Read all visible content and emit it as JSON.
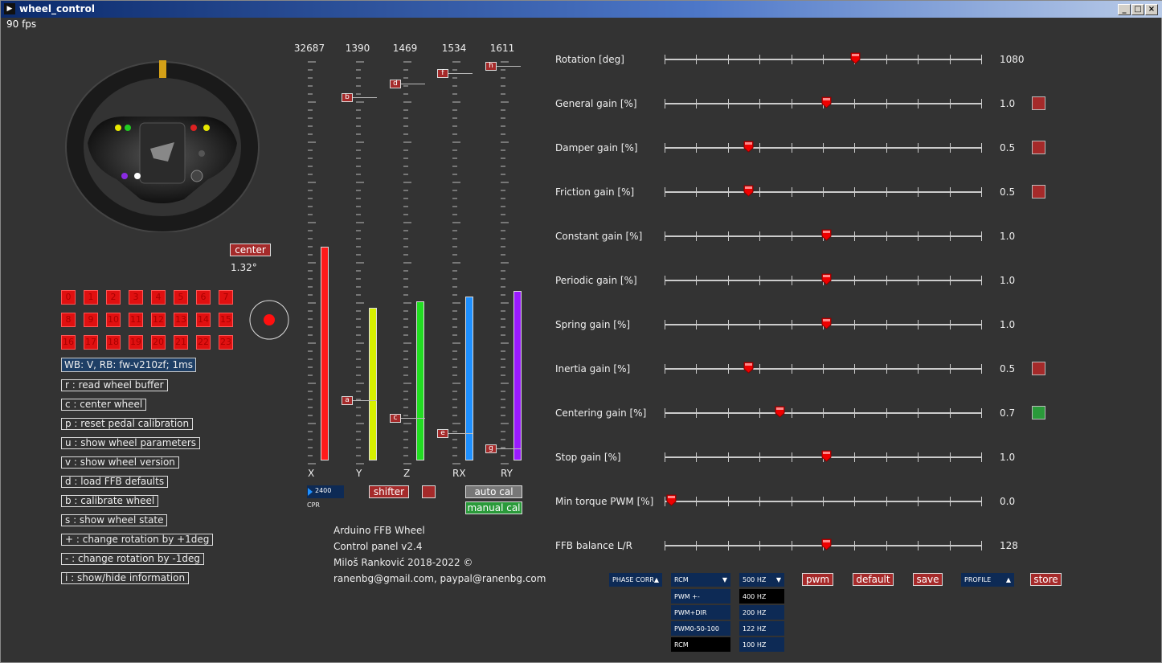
{
  "window": {
    "title": "wheel_control",
    "fps": "90 fps"
  },
  "wheel": {
    "center_label": "center",
    "angle": "1.32°"
  },
  "buttons": [
    "0",
    "1",
    "2",
    "3",
    "4",
    "5",
    "6",
    "7",
    "8",
    "9",
    "10",
    "11",
    "12",
    "13",
    "14",
    "15",
    "16",
    "17",
    "18",
    "19",
    "20",
    "21",
    "22",
    "23"
  ],
  "info_box": "WB: V, RB: fw-v210zf; 1ms",
  "commands": [
    "r : read wheel buffer",
    "c : center wheel",
    "p : reset pedal calibration",
    "u : show wheel parameters",
    "v : show wheel version",
    "d : load FFB defaults",
    "b : calibrate wheel",
    "s : show wheel state",
    "+ : change rotation by +1deg",
    "- : change rotation by -1deg",
    "i : show/hide information"
  ],
  "axes": [
    {
      "name": "X",
      "value": "32687",
      "color": "#ff1a1a",
      "fill": 0.555,
      "marker": ""
    },
    {
      "name": "Y",
      "value": "1390",
      "color": "#d6f000",
      "fill": 0.395,
      "marker": "a",
      "marker_top": "b"
    },
    {
      "name": "Z",
      "value": "1469",
      "color": "#22dd22",
      "fill": 0.413,
      "marker": "c",
      "marker_top": "d"
    },
    {
      "name": "RX",
      "value": "1534",
      "color": "#1e90ff",
      "fill": 0.426,
      "marker": "e",
      "marker_top": "f"
    },
    {
      "name": "RY",
      "value": "1611",
      "color": "#9a1aff",
      "fill": 0.44,
      "marker": "g",
      "marker_top": "h"
    }
  ],
  "cpr": {
    "value": "2400",
    "label": "CPR"
  },
  "shifter_label": "shifter",
  "auto_cal_label": "auto cal",
  "manual_cal_label": "manual cal",
  "about": [
    "Arduino FFB Wheel",
    "Control panel v2.4",
    "Miloš Ranković 2018-2022 ©",
    "ranenbg@gmail.com, paypal@ranenbg.com"
  ],
  "sliders": [
    {
      "label": "Rotation [deg]",
      "value": "1080",
      "pos": 0.595,
      "box": ""
    },
    {
      "label": "General gain [%]",
      "value": "1.0",
      "pos": 0.5,
      "box": "red"
    },
    {
      "label": "Damper gain [%]",
      "value": "0.5",
      "pos": 0.25,
      "box": "red"
    },
    {
      "label": "Friction gain [%]",
      "value": "0.5",
      "pos": 0.25,
      "box": "red"
    },
    {
      "label": "Constant gain [%]",
      "value": "1.0",
      "pos": 0.5,
      "box": ""
    },
    {
      "label": "Periodic gain [%]",
      "value": "1.0",
      "pos": 0.5,
      "box": ""
    },
    {
      "label": "Spring gain [%]",
      "value": "1.0",
      "pos": 0.5,
      "box": ""
    },
    {
      "label": "Inertia gain [%]",
      "value": "0.5",
      "pos": 0.25,
      "box": "red"
    },
    {
      "label": "Centering gain [%]",
      "value": "0.7",
      "pos": 0.35,
      "box": "green"
    },
    {
      "label": "Stop gain [%]",
      "value": "1.0",
      "pos": 0.5,
      "box": ""
    },
    {
      "label": "Min torque PWM [%]",
      "value": "0.0",
      "pos": 0.0,
      "box": ""
    },
    {
      "label": "FFB balance L/R",
      "value": "128",
      "pos": 0.5,
      "box": ""
    }
  ],
  "bottom": {
    "phase_corr": "PHASE CORR",
    "mode": "RCM",
    "mode_options": [
      "PWM +-",
      "PWM+DIR",
      "PWM0-50-100",
      "RCM"
    ],
    "freq": "500 HZ",
    "freq_options": [
      "400 HZ",
      "200 HZ",
      "122 HZ",
      "100 HZ"
    ],
    "pwm": "pwm",
    "default": "default",
    "save": "save",
    "profile": "PROFILE",
    "store": "store"
  },
  "colors": {
    "accent_red": "#a52a2a",
    "active_green": "#2a9a3a",
    "dropdown_blue": "#0d2a55"
  }
}
